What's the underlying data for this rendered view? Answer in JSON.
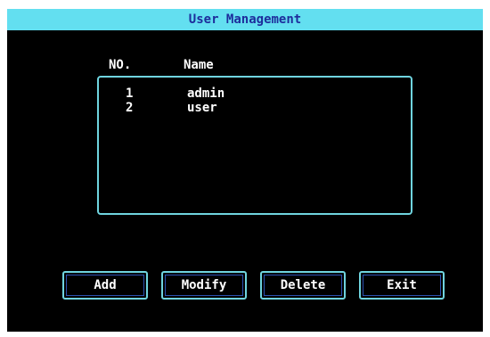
{
  "window": {
    "title": "User Management"
  },
  "columns": {
    "number": "NO.",
    "name": "Name"
  },
  "users": [
    {
      "no": "1",
      "name": "admin"
    },
    {
      "no": "2",
      "name": "user"
    }
  ],
  "buttons": {
    "add": "Add",
    "modify": "Modify",
    "delete": "Delete",
    "exit": "Exit"
  },
  "colors": {
    "title_bar": "#63dff0",
    "title_text": "#1d2d9c",
    "border": "#6fd4df",
    "background": "#000000",
    "text": "#ffffff"
  }
}
